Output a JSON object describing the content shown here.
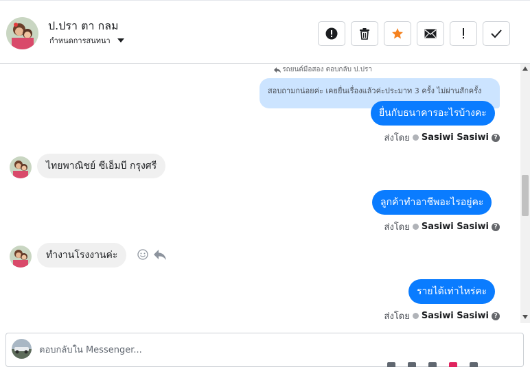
{
  "header": {
    "contact_name": "ป.ปรา ตา กลม",
    "assign_label": "กำหนดการสนทนา",
    "actions": [
      {
        "icon": "alert-circle-icon",
        "name": "mark-spam-button"
      },
      {
        "icon": "trash-icon",
        "name": "delete-button"
      },
      {
        "icon": "star-icon",
        "name": "star-button"
      },
      {
        "icon": "envelope-icon",
        "name": "mark-unread-button"
      },
      {
        "icon": "exclamation-icon",
        "name": "follow-up-button"
      },
      {
        "icon": "checkmark-icon",
        "name": "mark-done-button"
      }
    ]
  },
  "colors": {
    "outgoing_bubble": "#0a7cff",
    "incoming_bubble": "#f0f0f0",
    "quoted_bubble": "#cce4ff",
    "star_accent": "#f5821f"
  },
  "messages": {
    "reply_reference": "รถยนต์มือสอง ตอบกลับ ป.ปรา",
    "quoted_text": "สอบถามกน่อยค่ะ เคยยื่นเรื่องแล้วค่ะประมาท 3 ครั้ง ไม่ผ่านสักครั้ง",
    "out_1": "ยื่นกับธนาคารอะไรบ้างคะ",
    "in_1": "ไทยพาณิชย์  ซีเอ็มบี กรุงศรี",
    "out_2": "ลูกค้าทำอาชีพอะไรอยู่คะ",
    "in_2": "ทำงานโรงงานค่ะ",
    "out_3": "รายได้เท่าไหร่คะ",
    "sent_by_prefix": "ส่งโดย",
    "sent_by_name": "Sasiwi Sasiwi",
    "help": "?"
  },
  "composer": {
    "placeholder": "ตอบกลับใน Messenger..."
  }
}
